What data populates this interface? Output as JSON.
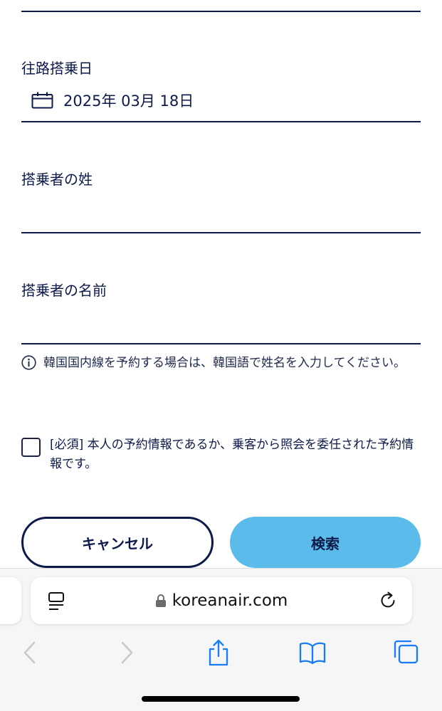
{
  "form": {
    "outbound_date": {
      "label": "往路搭乗日",
      "value": "2025年 03月 18日"
    },
    "last_name": {
      "label": "搭乗者の姓",
      "value": ""
    },
    "first_name": {
      "label": "搭乗者の名前",
      "value": ""
    },
    "notice": "韓国国内線を予約する場合は、韓国語で姓名を入力してください。",
    "agreement": {
      "text": "[必須] 本人の予約情報であるか、乗客から照会を委任された予約情報です。",
      "checked": false
    }
  },
  "buttons": {
    "cancel": "キャンセル",
    "search": "検索"
  },
  "browser": {
    "url": "koreanair.com"
  },
  "colors": {
    "navy": "#0e1a4a",
    "search_button": "#5bbcec",
    "toolbar_icon": "#1a7cf5"
  },
  "icons": [
    "calendar-icon",
    "info-icon",
    "reader-icon",
    "lock-icon",
    "reload-icon",
    "back-icon",
    "forward-icon",
    "share-icon",
    "bookmarks-icon",
    "tabs-icon"
  ]
}
